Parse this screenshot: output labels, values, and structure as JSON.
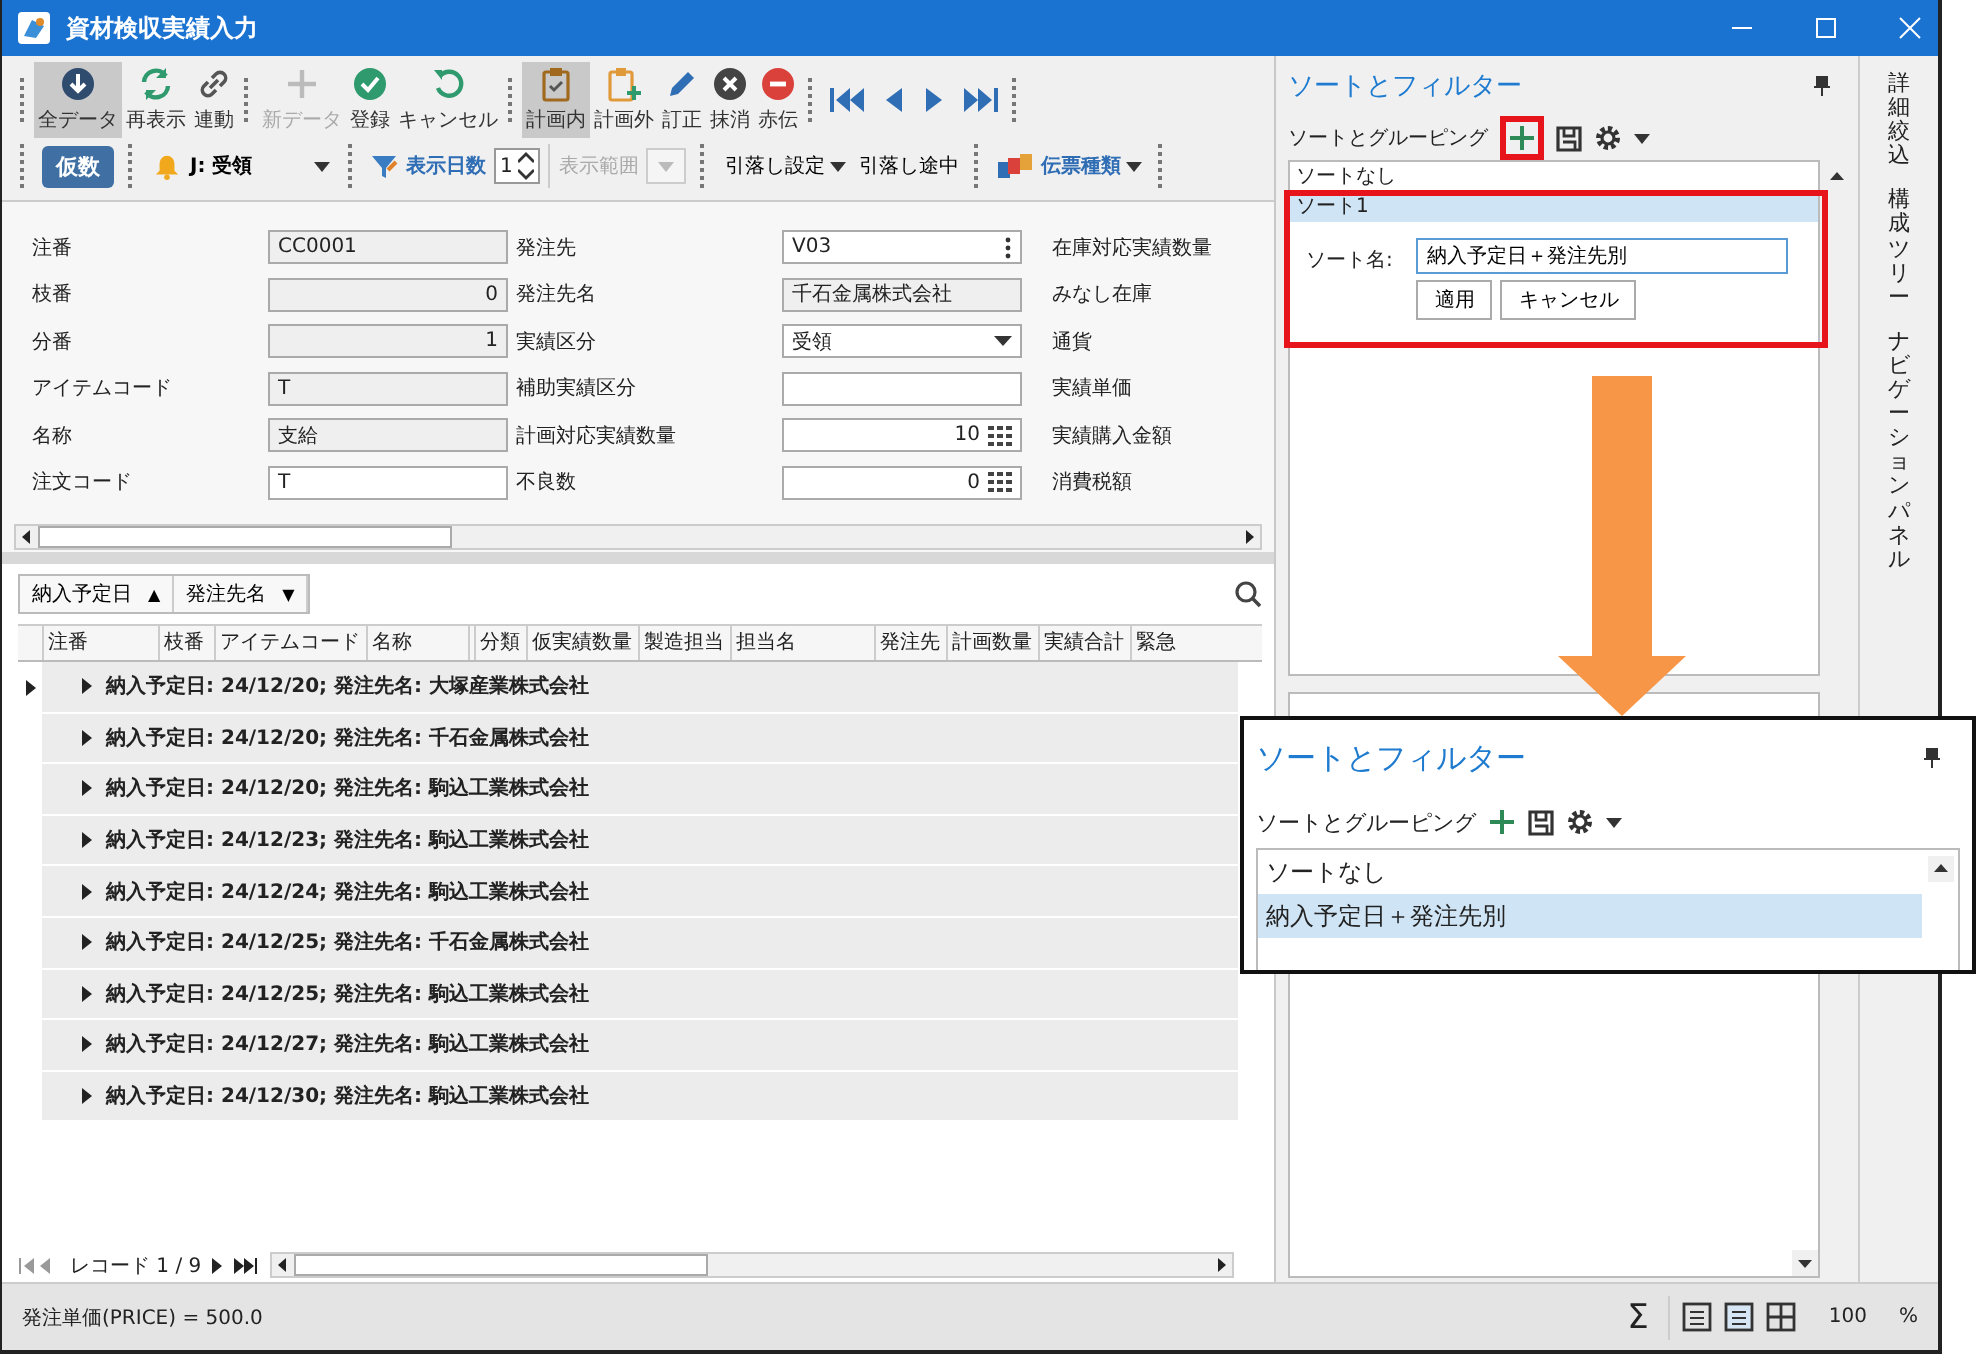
{
  "window": {
    "title": "資材検収実績入力"
  },
  "toolbar": {
    "buttons": [
      {
        "label": "全データ",
        "selected": true,
        "disabled": false
      },
      {
        "label": "再表示",
        "selected": false,
        "disabled": false
      },
      {
        "label": "連動",
        "selected": false,
        "disabled": false
      },
      {
        "label": "新データ",
        "selected": false,
        "disabled": true
      },
      {
        "label": "登録",
        "selected": false,
        "disabled": false
      },
      {
        "label": "キャンセル",
        "selected": false,
        "disabled": false
      },
      {
        "label": "計画内",
        "selected": true,
        "disabled": false
      },
      {
        "label": "計画外",
        "selected": false,
        "disabled": false
      },
      {
        "label": "訂正",
        "selected": false,
        "disabled": false
      },
      {
        "label": "抹消",
        "selected": false,
        "disabled": false
      },
      {
        "label": "赤伝",
        "selected": false,
        "disabled": false
      }
    ],
    "temp_button": "仮数",
    "status_value": "J: 受領",
    "days_label": "表示日数",
    "days_value": "1",
    "range_label": "表示範囲",
    "deduct_setting": "引落し設定",
    "deduct_pending": "引落し途中",
    "slip_type": "伝票種類"
  },
  "form": {
    "rows": [
      {
        "cells": [
          {
            "label": "注番",
            "value": "CC0001",
            "kind": "text",
            "readonly": true
          },
          {
            "label": "発注先",
            "value": "V03",
            "kind": "lookup",
            "readonly": false
          },
          {
            "label": "在庫対応実績数量"
          }
        ]
      },
      {
        "cells": [
          {
            "label": "枝番",
            "value": "0",
            "kind": "number",
            "readonly": true
          },
          {
            "label": "発注先名",
            "value": "千石金属株式会社",
            "kind": "text",
            "readonly": true
          },
          {
            "label": "みなし在庫"
          }
        ]
      },
      {
        "cells": [
          {
            "label": "分番",
            "value": "1",
            "kind": "number",
            "readonly": true
          },
          {
            "label": "実績区分",
            "value": "受領",
            "kind": "select",
            "readonly": false
          },
          {
            "label": "通貨"
          }
        ]
      },
      {
        "cells": [
          {
            "label": "アイテムコード",
            "value": "T",
            "kind": "text",
            "readonly": true
          },
          {
            "label": "補助実績区分",
            "kind": "text",
            "readonly": false
          },
          {
            "label": "実績単価"
          }
        ]
      },
      {
        "cells": [
          {
            "label": "名称",
            "value": "支給",
            "kind": "text",
            "readonly": true
          },
          {
            "label": "計画対応実績数量",
            "value": "10",
            "kind": "calc",
            "readonly": false
          },
          {
            "label": "実績購入金額"
          }
        ]
      },
      {
        "cells": [
          {
            "label": "注文コード",
            "value": "T",
            "kind": "text",
            "readonly": false
          },
          {
            "label": "不良数",
            "value": "0",
            "kind": "calc",
            "readonly": false
          },
          {
            "label": "消費税額"
          }
        ]
      }
    ]
  },
  "grid": {
    "group_by": [
      {
        "label": "納入予定日",
        "sort_symbol": "▲"
      },
      {
        "label": "発注先名",
        "sort_symbol": "▼"
      }
    ],
    "columns": [
      "注番",
      "枝番",
      "アイテムコード",
      "名称",
      "分類",
      "仮実績数量",
      "製造担当",
      "担当名",
      "発注先",
      "計画数量",
      "実績合計",
      "緊急"
    ],
    "groups": [
      {
        "text": "納入予定日: 24/12/20; 発注先名: 大塚産業株式会社",
        "expanded": false,
        "current": true
      },
      {
        "text": "納入予定日: 24/12/20; 発注先名: 千石金属株式会社",
        "expanded": false,
        "current": false
      },
      {
        "text": "納入予定日: 24/12/20; 発注先名: 駒込工業株式会社",
        "expanded": false,
        "current": false
      },
      {
        "text": "納入予定日: 24/12/23; 発注先名: 駒込工業株式会社",
        "expanded": false,
        "current": false
      },
      {
        "text": "納入予定日: 24/12/24; 発注先名: 駒込工業株式会社",
        "expanded": false,
        "current": false
      },
      {
        "text": "納入予定日: 24/12/25; 発注先名: 千石金属株式会社",
        "expanded": false,
        "current": false
      },
      {
        "text": "納入予定日: 24/12/25; 発注先名: 駒込工業株式会社",
        "expanded": false,
        "current": false
      },
      {
        "text": "納入予定日: 24/12/27; 発注先名: 駒込工業株式会社",
        "expanded": false,
        "current": false
      },
      {
        "text": "納入予定日: 24/12/30; 発注先名: 駒込工業株式会社",
        "expanded": false,
        "current": false
      }
    ],
    "pager": "レコード 1 / 9"
  },
  "sort_panel": {
    "title": "ソートとフィルター",
    "toolbar_label": "ソートとグルーピング",
    "items": [
      {
        "label": "ソートなし",
        "selected": false
      },
      {
        "label": "ソート1",
        "selected": true
      }
    ],
    "editor": {
      "name_label": "ソート名:",
      "name_value": "納入予定日＋発注先別",
      "buttons": [
        "適用",
        "キャンセル"
      ]
    }
  },
  "callout": {
    "title": "ソートとフィルター",
    "toolbar_label": "ソートとグルーピング",
    "items": [
      {
        "label": "ソートなし",
        "selected": false
      },
      {
        "label": "納入予定日＋発注先別",
        "selected": true
      }
    ]
  },
  "side_tabs": [
    "詳細絞込",
    "構成ツリー",
    "ナビゲーションパネル"
  ],
  "status_bar": {
    "text": "発注単価(PRICE) = 500.0",
    "sum_symbol": "Σ",
    "zoom": "100",
    "percent": "%"
  }
}
